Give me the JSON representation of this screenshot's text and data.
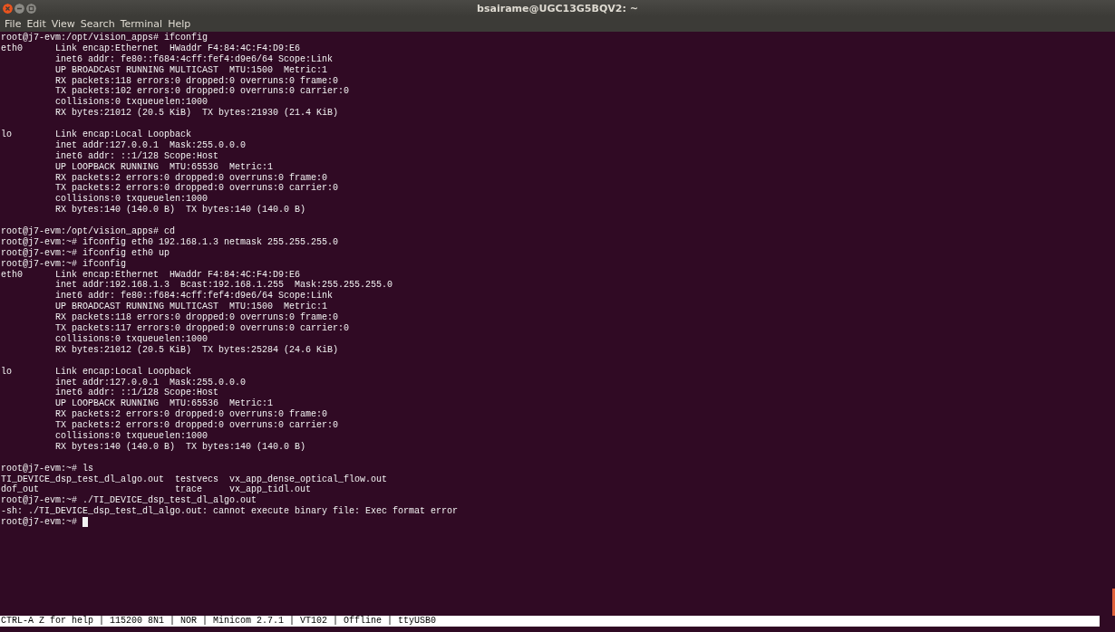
{
  "window": {
    "title": "bsairame@UGC13G5BQV2: ~"
  },
  "menu": [
    "File",
    "Edit",
    "View",
    "Search",
    "Terminal",
    "Help"
  ],
  "terminal": {
    "blocks": [
      [
        "root@j7-evm:/opt/vision_apps# ifconfig",
        "eth0      Link encap:Ethernet  HWaddr F4:84:4C:F4:D9:E6",
        "          inet6 addr: fe80::f684:4cff:fef4:d9e6/64 Scope:Link",
        "          UP BROADCAST RUNNING MULTICAST  MTU:1500  Metric:1",
        "          RX packets:118 errors:0 dropped:0 overruns:0 frame:0",
        "          TX packets:102 errors:0 dropped:0 overruns:0 carrier:0",
        "          collisions:0 txqueuelen:1000",
        "          RX bytes:21012 (20.5 KiB)  TX bytes:21930 (21.4 KiB)"
      ],
      [
        "lo        Link encap:Local Loopback",
        "          inet addr:127.0.0.1  Mask:255.0.0.0",
        "          inet6 addr: ::1/128 Scope:Host",
        "          UP LOOPBACK RUNNING  MTU:65536  Metric:1",
        "          RX packets:2 errors:0 dropped:0 overruns:0 frame:0",
        "          TX packets:2 errors:0 dropped:0 overruns:0 carrier:0",
        "          collisions:0 txqueuelen:1000",
        "          RX bytes:140 (140.0 B)  TX bytes:140 (140.0 B)"
      ],
      [
        "root@j7-evm:/opt/vision_apps# cd",
        "root@j7-evm:~# ifconfig eth0 192.168.1.3 netmask 255.255.255.0",
        "root@j7-evm:~# ifconfig eth0 up",
        "root@j7-evm:~# ifconfig",
        "eth0      Link encap:Ethernet  HWaddr F4:84:4C:F4:D9:E6",
        "          inet addr:192.168.1.3  Bcast:192.168.1.255  Mask:255.255.255.0",
        "          inet6 addr: fe80::f684:4cff:fef4:d9e6/64 Scope:Link",
        "          UP BROADCAST RUNNING MULTICAST  MTU:1500  Metric:1",
        "          RX packets:118 errors:0 dropped:0 overruns:0 frame:0",
        "          TX packets:117 errors:0 dropped:0 overruns:0 carrier:0",
        "          collisions:0 txqueuelen:1000",
        "          RX bytes:21012 (20.5 KiB)  TX bytes:25284 (24.6 KiB)"
      ],
      [
        "lo        Link encap:Local Loopback",
        "          inet addr:127.0.0.1  Mask:255.0.0.0",
        "          inet6 addr: ::1/128 Scope:Host",
        "          UP LOOPBACK RUNNING  MTU:65536  Metric:1",
        "          RX packets:2 errors:0 dropped:0 overruns:0 frame:0",
        "          TX packets:2 errors:0 dropped:0 overruns:0 carrier:0",
        "          collisions:0 txqueuelen:1000",
        "          RX bytes:140 (140.0 B)  TX bytes:140 (140.0 B)"
      ],
      [
        "root@j7-evm:~# ls",
        "TI_DEVICE_dsp_test_dl_algo.out  testvecs  vx_app_dense_optical_flow.out",
        "dof_out                         trace     vx_app_tidl.out",
        "root@j7-evm:~# ./TI_DEVICE_dsp_test_dl_algo.out",
        "-sh: ./TI_DEVICE_dsp_test_dl_algo.out: cannot execute binary file: Exec format error",
        "root@j7-evm:~# "
      ]
    ]
  },
  "status_bar": "CTRL-A Z for help | 115200 8N1 | NOR | Minicom 2.7.1 | VT102 | Offline | ttyUSB0"
}
